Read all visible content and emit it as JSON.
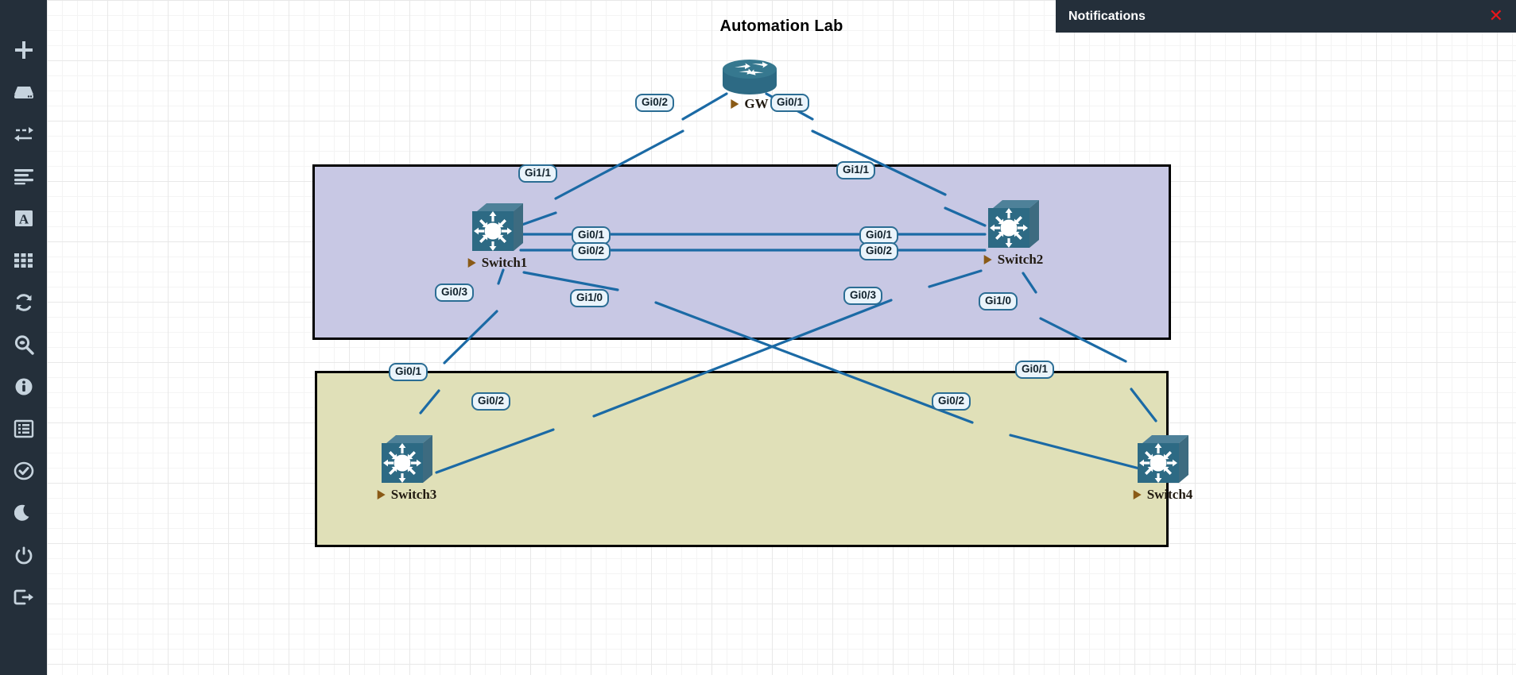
{
  "app": {
    "canvas_title": "Automation Lab"
  },
  "notifications": {
    "title": "Notifications",
    "close_label": "✕"
  },
  "sidebar": {
    "items": [
      {
        "name": "add-node-icon",
        "label": "Add node"
      },
      {
        "name": "device-icon",
        "label": "Devices"
      },
      {
        "name": "link-icon",
        "label": "Links"
      },
      {
        "name": "align-icon",
        "label": "Align"
      },
      {
        "name": "text-icon",
        "label": "Text"
      },
      {
        "name": "grid-icon",
        "label": "Grid"
      },
      {
        "name": "refresh-icon",
        "label": "Refresh"
      },
      {
        "name": "search-icon",
        "label": "Search"
      },
      {
        "name": "info-icon",
        "label": "Info"
      },
      {
        "name": "list-icon",
        "label": "Console list"
      },
      {
        "name": "check-icon",
        "label": "Status"
      },
      {
        "name": "moon-icon",
        "label": "Dark mode"
      },
      {
        "name": "power-icon",
        "label": "Power"
      },
      {
        "name": "logout-icon",
        "label": "Log out"
      }
    ]
  },
  "topology": {
    "zones": [
      {
        "id": "zone-purple",
        "color": "#c8c8e4",
        "border": "#000000"
      },
      {
        "id": "zone-olive",
        "color": "#e0e0b8",
        "border": "#000000"
      }
    ],
    "nodes": [
      {
        "id": "gw",
        "label": "GW",
        "type": "router"
      },
      {
        "id": "switch1",
        "label": "Switch1",
        "type": "switch"
      },
      {
        "id": "switch2",
        "label": "Switch2",
        "type": "switch"
      },
      {
        "id": "switch3",
        "label": "Switch3",
        "type": "switch"
      },
      {
        "id": "switch4",
        "label": "Switch4",
        "type": "switch"
      }
    ],
    "link_color": "#1b6aa5",
    "interface_labels": [
      {
        "id": "gw-gi02",
        "text": "Gi0/2"
      },
      {
        "id": "gw-gi01",
        "text": "Gi0/1"
      },
      {
        "id": "sw1-gi11",
        "text": "Gi1/1"
      },
      {
        "id": "sw2-gi11",
        "text": "Gi1/1"
      },
      {
        "id": "sw1-gi01",
        "text": "Gi0/1"
      },
      {
        "id": "sw1-gi02",
        "text": "Gi0/2"
      },
      {
        "id": "sw2-gi01",
        "text": "Gi0/1"
      },
      {
        "id": "sw2-gi02",
        "text": "Gi0/2"
      },
      {
        "id": "sw1-gi03",
        "text": "Gi0/3"
      },
      {
        "id": "sw1-gi10",
        "text": "Gi1/0"
      },
      {
        "id": "sw2-gi03",
        "text": "Gi0/3"
      },
      {
        "id": "sw2-gi10",
        "text": "Gi1/0"
      },
      {
        "id": "sw3-gi01",
        "text": "Gi0/1"
      },
      {
        "id": "sw3-gi02",
        "text": "Gi0/2"
      },
      {
        "id": "sw4-gi02",
        "text": "Gi0/2"
      },
      {
        "id": "sw4-gi01",
        "text": "Gi0/1"
      }
    ]
  }
}
